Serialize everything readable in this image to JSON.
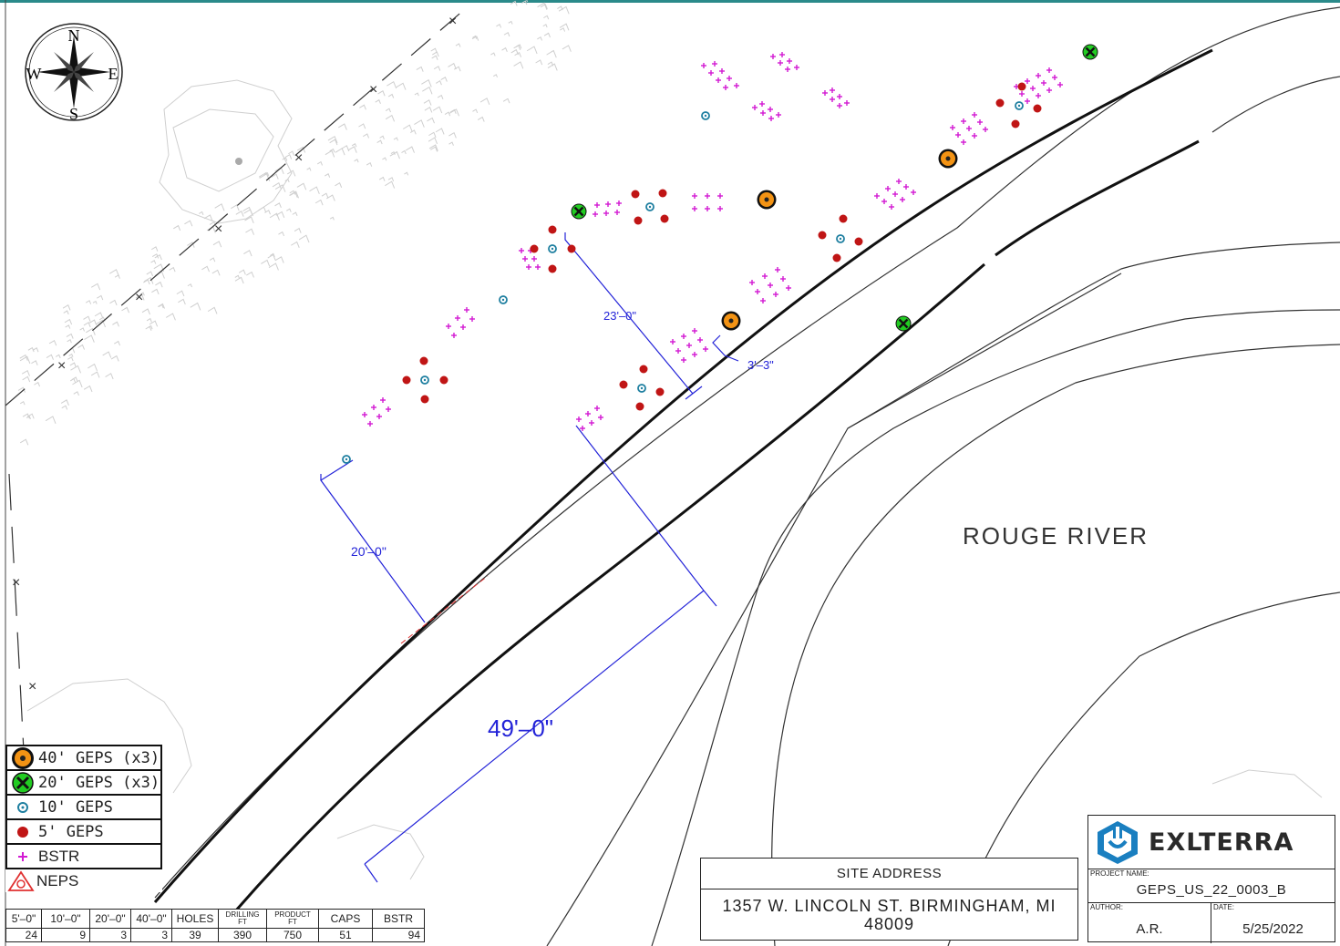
{
  "compass": {
    "n": "N",
    "s": "S",
    "e": "E",
    "w": "W"
  },
  "river_label": "ROUGE RIVER",
  "dimensions": {
    "d1": "23'–0\"",
    "d2": "3'–3\"",
    "d3": "20'–0\"",
    "d4": "49'–0\""
  },
  "legend": [
    {
      "icon": "geps-40-icon",
      "label": "40' GEPS (x3)"
    },
    {
      "icon": "geps-20-icon",
      "label": "20' GEPS (x3)"
    },
    {
      "icon": "geps-10-icon",
      "label": "10' GEPS"
    },
    {
      "icon": "geps-5-icon",
      "label": "5' GEPS"
    },
    {
      "icon": "bstr-icon",
      "label": "BSTR"
    },
    {
      "icon": "neps-icon",
      "label": "NEPS"
    }
  ],
  "quantities": {
    "headers": [
      "5'–0\"",
      "10'–0\"",
      "20'–0\"",
      "40'–0\"",
      "HOLES",
      "DRILLING FT",
      "PRODUCT FT",
      "CAPS",
      "BSTR"
    ],
    "values": [
      "24",
      "9",
      "3",
      "3",
      "39",
      "390",
      "750",
      "51",
      "94"
    ]
  },
  "site": {
    "header": "SITE ADDRESS",
    "line1": "1357 W. LINCOLN ST. BIRMINGHAM, MI",
    "line2": "48009"
  },
  "title_block": {
    "company": "EXLTERRA",
    "project_label": "PROJECT NAME:",
    "project": "GEPS_US_22_0003_B",
    "author_label": "AUTHOR:",
    "author": "A.R.",
    "date_label": "DATE:",
    "date": "5/25/2022"
  },
  "colors": {
    "dimension": "#2323d8",
    "geps40": "#f39314",
    "geps20": "#22cc22",
    "geps10": "#1e7fa0",
    "geps5": "#c01515",
    "bstr": "#d21ad2",
    "brand": "#1a7fc0"
  }
}
